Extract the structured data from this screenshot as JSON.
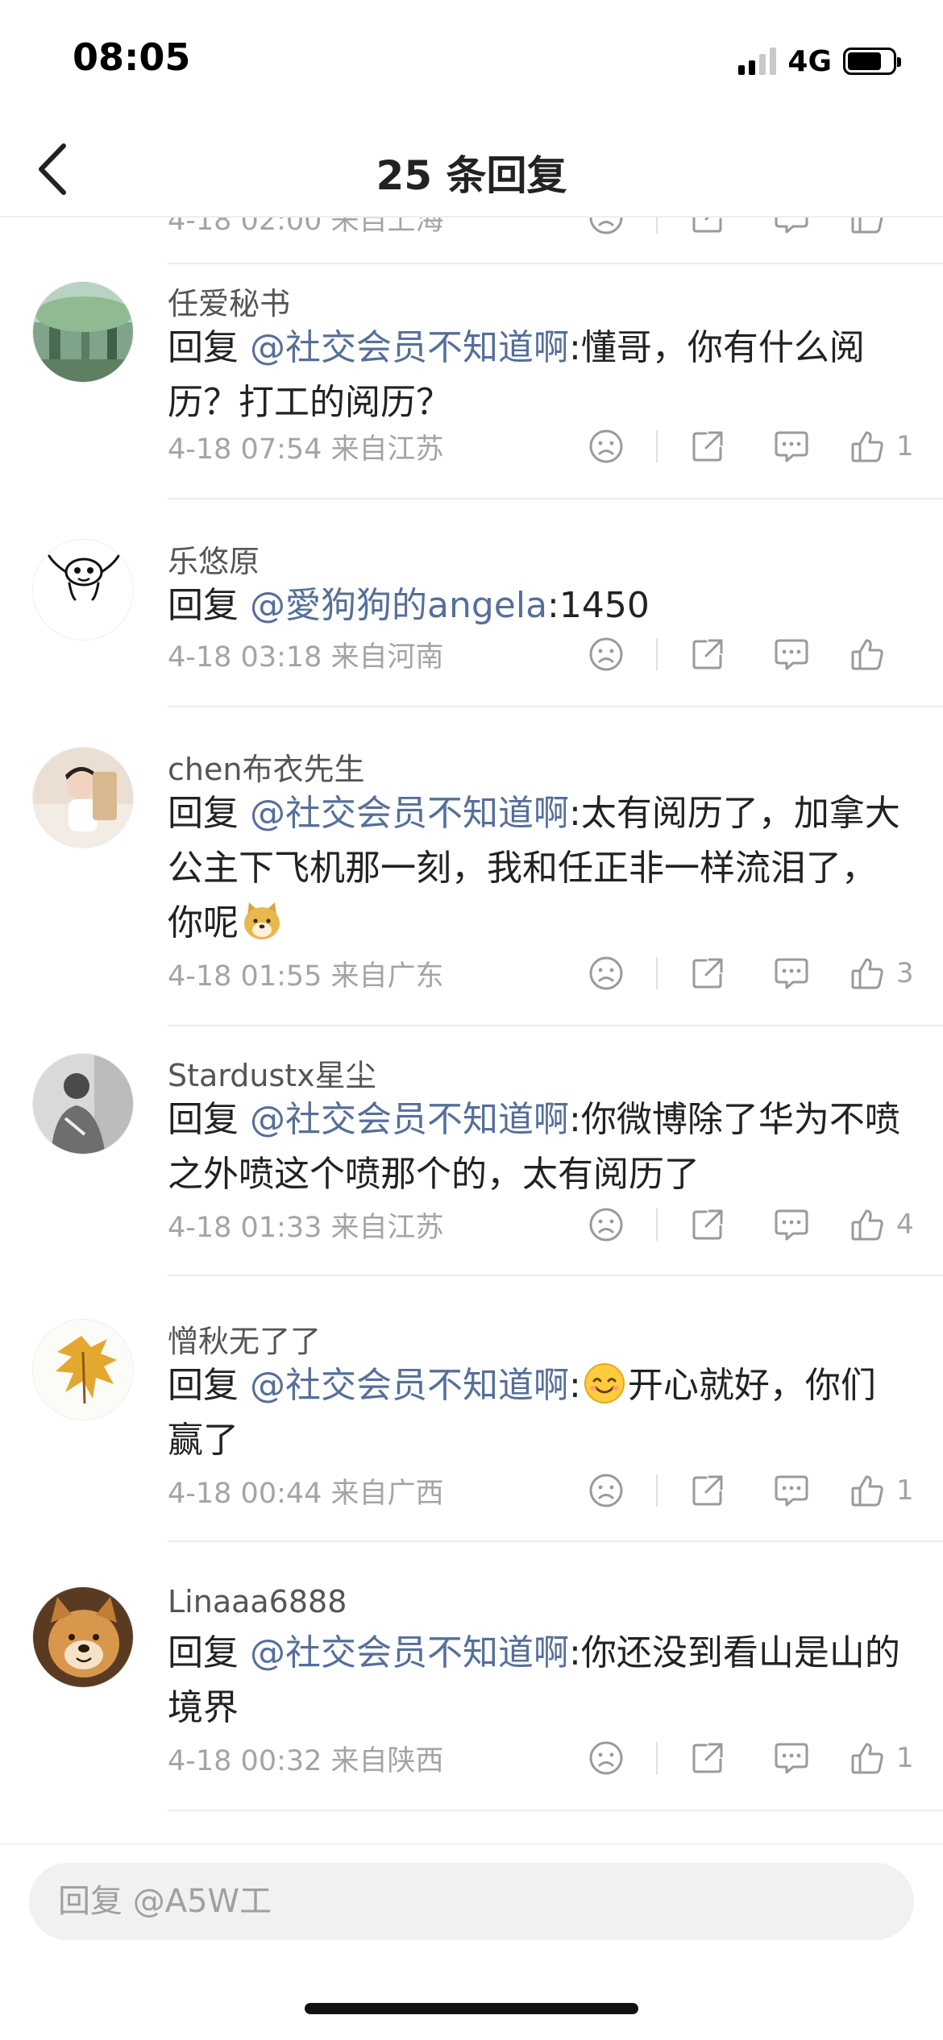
{
  "status_bar": {
    "time": "08:05",
    "network": "4G"
  },
  "header": {
    "title": "25 条回复"
  },
  "partial_item": {
    "meta": "4-18 02:00 来自上海"
  },
  "comments": [
    {
      "username": "任爱秘书",
      "reply_prefix": "回复 ",
      "mention": "@社交会员不知道啊",
      "text_before": ":懂哥，你有什么阅历？打工的阅历？",
      "emoji": "",
      "text_after": "",
      "meta": "4-18 07:54 来自江苏",
      "likes": "1"
    },
    {
      "username": "乐悠原",
      "reply_prefix": "回复 ",
      "mention": "@愛狗狗的angela",
      "text_before": ":1450",
      "emoji": "",
      "text_after": "",
      "meta": "4-18 03:18 来自河南",
      "likes": ""
    },
    {
      "username": "chen布衣先生",
      "reply_prefix": "回复 ",
      "mention": "@社交会员不知道啊",
      "text_before": ":太有阅历了，加拿大公主下飞机那一刻，我和任正非一样流泪了，你呢",
      "emoji": "doge-emoji",
      "text_after": "",
      "meta": "4-18 01:55 来自广东",
      "likes": "3"
    },
    {
      "username": "Stardustx星尘",
      "reply_prefix": "回复 ",
      "mention": "@社交会员不知道啊",
      "text_before": ":你微博除了华为不喷之外喷这个喷那个的，太有阅历了",
      "emoji": "",
      "text_after": "",
      "meta": "4-18 01:33 来自江苏",
      "likes": "4"
    },
    {
      "username": "憎秋无了了",
      "reply_prefix": "回复 ",
      "mention": "@社交会员不知道啊",
      "text_before": ":",
      "emoji": "smile-emoji",
      "text_after": "开心就好，你们赢了",
      "meta": "4-18 00:44 来自广西",
      "likes": "1"
    },
    {
      "username": "Linaaa6888",
      "reply_prefix": "回复 ",
      "mention": "@社交会员不知道啊",
      "text_before": ":你还没到看山是山的境界",
      "emoji": "",
      "text_after": "",
      "meta": "4-18 00:32 来自陕西",
      "likes": "1"
    }
  ],
  "reply_box": {
    "placeholder": "回复 @A5W工"
  },
  "colors": {
    "mention": "#556f9a",
    "meta": "#a4a4a4",
    "divider": "#ececec",
    "input_bg": "#f1f1f1"
  },
  "icons": [
    "chevron-left-icon",
    "frown-icon",
    "share-icon",
    "comment-icon",
    "thumbs-up-icon"
  ]
}
